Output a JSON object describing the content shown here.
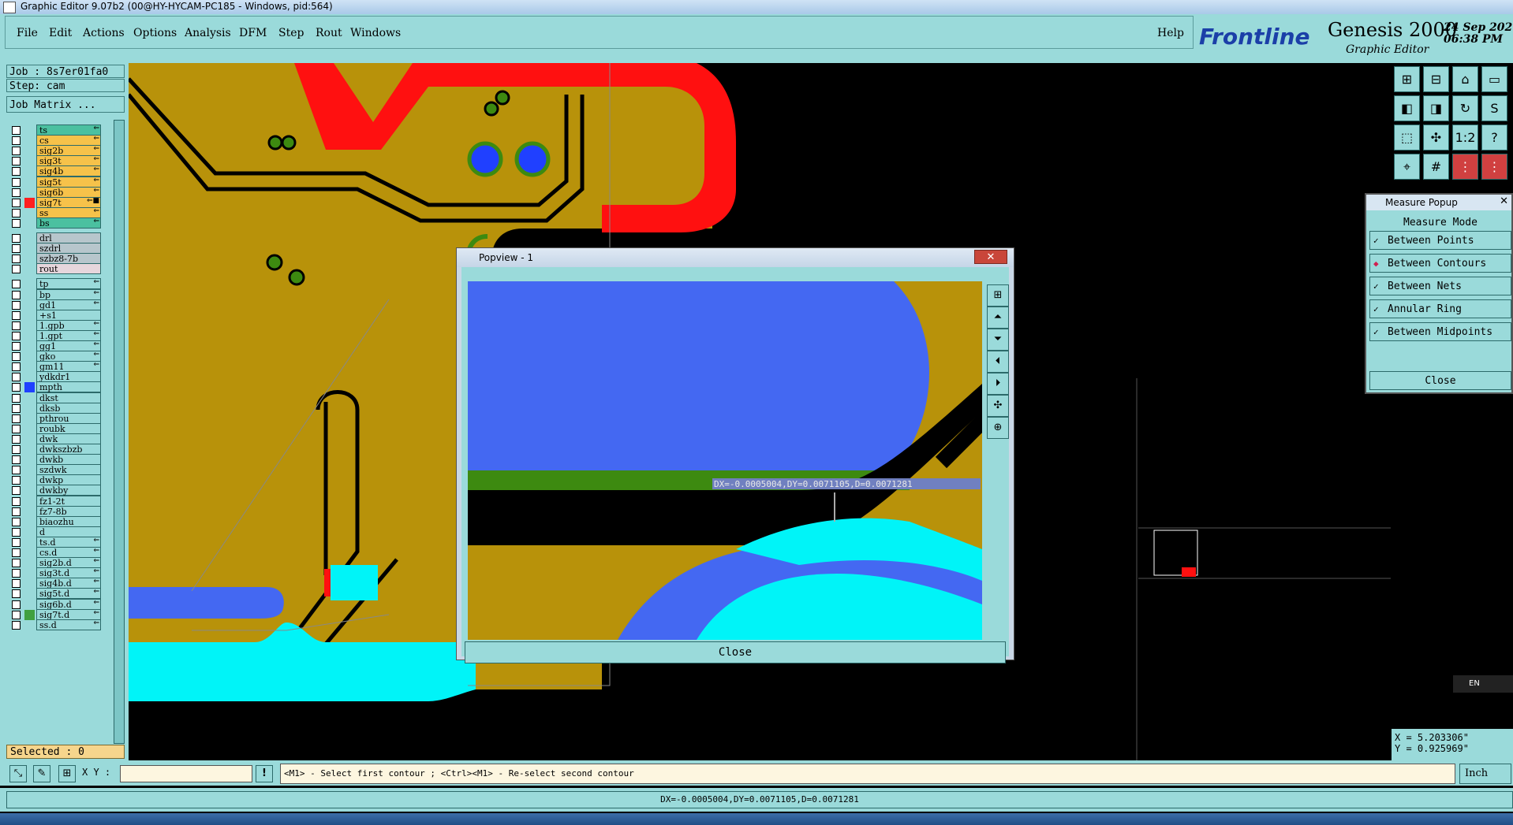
{
  "window": {
    "title": "Graphic Editor 9.07b2 (00@HY-HYCAM-PC185 - Windows, pid:564)"
  },
  "menu": {
    "items": [
      "File",
      "Edit",
      "Actions",
      "Options",
      "Analysis",
      "DFM",
      "Step",
      "Rout",
      "Windows"
    ],
    "help": "Help"
  },
  "brand": {
    "company": "Frontline",
    "product": "Genesis 2000",
    "subtitle": "Graphic Editor",
    "date": "24 Sep 202",
    "time": "06:38 PM"
  },
  "job": {
    "job_label": "Job : 8s7er01fa0",
    "step_label": "Step: cam",
    "matrix_button": "Job Matrix ..."
  },
  "layers": [
    {
      "name": "ts",
      "color": "#4bc0a0",
      "swatch": "",
      "mark": "⇐"
    },
    {
      "name": "cs",
      "color": "#f6c24a",
      "swatch": "",
      "mark": "⇐"
    },
    {
      "name": "sig2b",
      "color": "#f6c24a",
      "swatch": "",
      "mark": "⇐"
    },
    {
      "name": "sig3t",
      "color": "#f6c24a",
      "swatch": "",
      "mark": "⇐"
    },
    {
      "name": "sig4b",
      "color": "#f6c24a",
      "swatch": "",
      "mark": "⇐"
    },
    {
      "name": "sig5t",
      "color": "#f6c24a",
      "swatch": "",
      "mark": "⇐"
    },
    {
      "name": "sig6b",
      "color": "#f6c24a",
      "swatch": "",
      "mark": "⇐"
    },
    {
      "name": "sig7t",
      "color": "#f6c24a",
      "swatch": "#ff2020",
      "mark": "⇐■"
    },
    {
      "name": "ss",
      "color": "#f6c24a",
      "swatch": "",
      "mark": "⇐"
    },
    {
      "name": "bs",
      "color": "#4bc0a0",
      "swatch": "",
      "mark": "⇐"
    },
    {
      "name": "drl",
      "color": "#b7c6cc",
      "swatch": "",
      "mark": ""
    },
    {
      "name": "szdrl",
      "color": "#b7c6cc",
      "swatch": "",
      "mark": ""
    },
    {
      "name": "szbz8-7b",
      "color": "#b7c6cc",
      "swatch": "",
      "mark": ""
    },
    {
      "name": "rout",
      "color": "#e6d6dc",
      "swatch": "",
      "mark": ""
    },
    {
      "name": "tp",
      "color": "#9adada",
      "swatch": "",
      "mark": "⇐"
    },
    {
      "name": "bp",
      "color": "#9adada",
      "swatch": "",
      "mark": "⇐"
    },
    {
      "name": "gd1",
      "color": "#9adada",
      "swatch": "",
      "mark": "⇐"
    },
    {
      "name": "+s1",
      "color": "#9adada",
      "swatch": "",
      "mark": ""
    },
    {
      "name": "1.gpb",
      "color": "#9adada",
      "swatch": "",
      "mark": "⇐"
    },
    {
      "name": "1.gpt",
      "color": "#9adada",
      "swatch": "",
      "mark": "⇐"
    },
    {
      "name": "gg1",
      "color": "#9adada",
      "swatch": "",
      "mark": "⇐"
    },
    {
      "name": "gko",
      "color": "#9adada",
      "swatch": "",
      "mark": "⇐"
    },
    {
      "name": "gm11",
      "color": "#9adada",
      "swatch": "",
      "mark": "⇐"
    },
    {
      "name": "ydkdr1",
      "color": "#9adada",
      "swatch": "",
      "mark": ""
    },
    {
      "name": "mpth",
      "color": "#9adada",
      "swatch": "#2040ff",
      "mark": ""
    },
    {
      "name": "dkst",
      "color": "#9adada",
      "swatch": "",
      "mark": ""
    },
    {
      "name": "dksb",
      "color": "#9adada",
      "swatch": "",
      "mark": ""
    },
    {
      "name": "pthrou",
      "color": "#9adada",
      "swatch": "",
      "mark": ""
    },
    {
      "name": "roubk",
      "color": "#9adada",
      "swatch": "",
      "mark": ""
    },
    {
      "name": "dwk",
      "color": "#9adada",
      "swatch": "",
      "mark": ""
    },
    {
      "name": "dwkszbzb",
      "color": "#9adada",
      "swatch": "",
      "mark": ""
    },
    {
      "name": "dwkb",
      "color": "#9adada",
      "swatch": "",
      "mark": ""
    },
    {
      "name": "szdwk",
      "color": "#9adada",
      "swatch": "",
      "mark": ""
    },
    {
      "name": "dwkp",
      "color": "#9adada",
      "swatch": "",
      "mark": ""
    },
    {
      "name": "dwkby",
      "color": "#9adada",
      "swatch": "",
      "mark": ""
    },
    {
      "name": "fz1-2t",
      "color": "#9adada",
      "swatch": "",
      "mark": ""
    },
    {
      "name": "fz7-8b",
      "color": "#9adada",
      "swatch": "",
      "mark": ""
    },
    {
      "name": "biaozhu",
      "color": "#9adada",
      "swatch": "",
      "mark": ""
    },
    {
      "name": "d",
      "color": "#9adada",
      "swatch": "",
      "mark": ""
    },
    {
      "name": "ts.d",
      "color": "#9adada",
      "swatch": "",
      "mark": "⇐"
    },
    {
      "name": "cs.d",
      "color": "#9adada",
      "swatch": "",
      "mark": "⇐"
    },
    {
      "name": "sig2b.d",
      "color": "#9adada",
      "swatch": "",
      "mark": "⇐"
    },
    {
      "name": "sig3t.d",
      "color": "#9adada",
      "swatch": "",
      "mark": "⇐"
    },
    {
      "name": "sig4b.d",
      "color": "#9adada",
      "swatch": "",
      "mark": "⇐"
    },
    {
      "name": "sig5t.d",
      "color": "#9adada",
      "swatch": "",
      "mark": "⇐"
    },
    {
      "name": "sig6b.d",
      "color": "#9adada",
      "swatch": "",
      "mark": "⇐"
    },
    {
      "name": "sig7t.d",
      "color": "#9adada",
      "swatch": "#40a040",
      "mark": "⇐"
    },
    {
      "name": "ss.d",
      "color": "#9adada",
      "swatch": "",
      "mark": "⇐"
    }
  ],
  "selected_label": "Selected : 0",
  "measure_popup": {
    "title": "Measure Popup",
    "mode_label": "Measure Mode",
    "options": [
      {
        "label": "Between Points",
        "active": false
      },
      {
        "label": "Between Contours",
        "active": true
      },
      {
        "label": "Between Nets",
        "active": false
      },
      {
        "label": "Annular Ring",
        "active": false
      },
      {
        "label": "Between Midpoints",
        "active": false
      }
    ],
    "close": "Close"
  },
  "popview": {
    "title": "Popview - 1",
    "close": "Close",
    "measure_text": "DX=-0.0005004,DY=0.0071105,D=0.0071281"
  },
  "coords": {
    "x": "X = 5.203306\"",
    "y": "Y = 0.925969\""
  },
  "command": {
    "xy_label": "X Y :",
    "xy_value": "",
    "prompt": "<M1> - Select first contour ; <Ctrl><M1> - Re-select second contour",
    "units": "Inch"
  },
  "status": {
    "measure": "DX=-0.0005004,DY=0.0071105,D=0.0071281"
  },
  "lang": "EN"
}
